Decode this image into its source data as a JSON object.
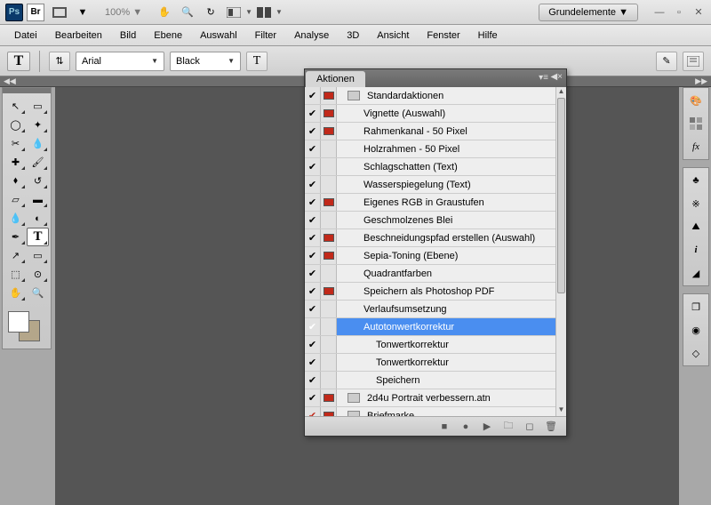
{
  "topbar": {
    "ps_label": "Ps",
    "br_label": "Br",
    "zoom": "100% ▼",
    "workspace": "Grundelemente ▼"
  },
  "menus": [
    "Datei",
    "Bearbeiten",
    "Bild",
    "Ebene",
    "Auswahl",
    "Filter",
    "Analyse",
    "3D",
    "Ansicht",
    "Fenster",
    "Hilfe"
  ],
  "options": {
    "font_family": "Arial",
    "font_style": "Black"
  },
  "actions_panel": {
    "title": "Aktionen",
    "rows": [
      {
        "chk": true,
        "dlg": "red",
        "tri": "down",
        "indent": 0,
        "folder": true,
        "label": "Standardaktionen"
      },
      {
        "chk": true,
        "dlg": "red",
        "tri": "right",
        "indent": 1,
        "label": "Vignette (Auswahl)"
      },
      {
        "chk": true,
        "dlg": "red",
        "tri": "right",
        "indent": 1,
        "label": "Rahmenkanal - 50 Pixel"
      },
      {
        "chk": true,
        "dlg": "none",
        "tri": "right",
        "indent": 1,
        "label": "Holzrahmen - 50 Pixel"
      },
      {
        "chk": true,
        "dlg": "none",
        "tri": "right",
        "indent": 1,
        "label": "Schlagschatten (Text)"
      },
      {
        "chk": true,
        "dlg": "none",
        "tri": "right",
        "indent": 1,
        "label": "Wasserspiegelung (Text)"
      },
      {
        "chk": true,
        "dlg": "red",
        "tri": "right",
        "indent": 1,
        "label": "Eigenes RGB in Graustufen"
      },
      {
        "chk": true,
        "dlg": "none",
        "tri": "right",
        "indent": 1,
        "label": "Geschmolzenes Blei"
      },
      {
        "chk": true,
        "dlg": "red",
        "tri": "right",
        "indent": 1,
        "label": "Beschneidungspfad erstellen (Auswahl)"
      },
      {
        "chk": true,
        "dlg": "red",
        "tri": "right",
        "indent": 1,
        "label": "Sepia-Toning (Ebene)"
      },
      {
        "chk": true,
        "dlg": "none",
        "tri": "right",
        "indent": 1,
        "label": "Quadrantfarben"
      },
      {
        "chk": true,
        "dlg": "red",
        "tri": "right",
        "indent": 1,
        "label": "Speichern als Photoshop PDF"
      },
      {
        "chk": true,
        "dlg": "none",
        "tri": "right",
        "indent": 1,
        "label": "Verlaufsumsetzung"
      },
      {
        "chk": true,
        "dlg": "none",
        "tri": "down",
        "indent": 1,
        "label": "Autotonwertkorrektur",
        "selected": true
      },
      {
        "chk": true,
        "dlg": "none",
        "tri": "right",
        "indent": 2,
        "label": "Tonwertkorrektur"
      },
      {
        "chk": true,
        "dlg": "none",
        "tri": "right",
        "indent": 2,
        "label": "Tonwertkorrektur"
      },
      {
        "chk": true,
        "dlg": "none",
        "tri": "right",
        "indent": 2,
        "label": "Speichern"
      },
      {
        "chk": true,
        "dlg": "red",
        "tri": "right",
        "indent": 0,
        "folder": true,
        "label": "2d4u Portrait verbessern.atn"
      },
      {
        "chk": true,
        "dlg": "red",
        "tri": "right",
        "indent": 0,
        "folder": true,
        "label": "Briefmarke",
        "chkred": true
      }
    ]
  }
}
